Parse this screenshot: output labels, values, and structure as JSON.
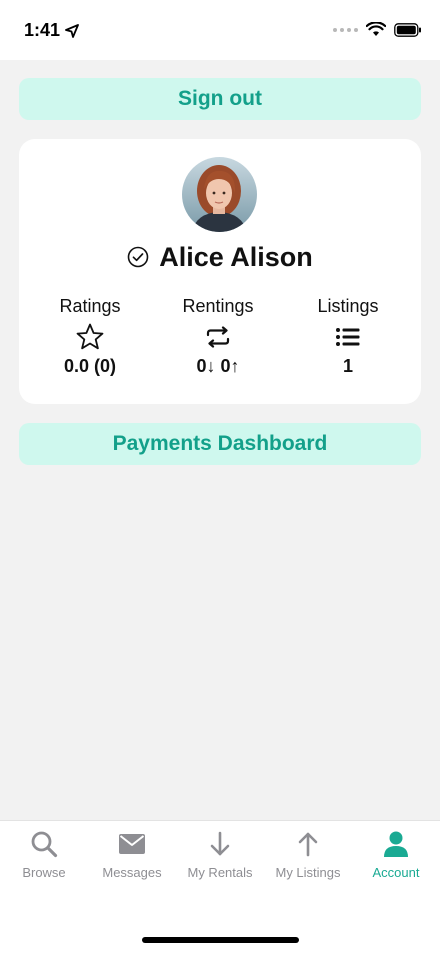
{
  "status_bar": {
    "time": "1:41"
  },
  "header": {
    "sign_out_label": "Sign out"
  },
  "profile": {
    "name": "Alice Alison",
    "stats": {
      "ratings": {
        "label": "Ratings",
        "value": "0.0 (0)",
        "icon": "star-icon"
      },
      "rentings": {
        "label": "Rentings",
        "value": "0↓ 0↑",
        "icon": "repeat-icon"
      },
      "listings": {
        "label": "Listings",
        "value": "1",
        "icon": "list-icon"
      }
    }
  },
  "payments": {
    "label": "Payments Dashboard"
  },
  "tabs": [
    {
      "label": "Browse",
      "icon": "search-icon",
      "active": false
    },
    {
      "label": "Messages",
      "icon": "mail-icon",
      "active": false
    },
    {
      "label": "My Rentals",
      "icon": "arrow-down-icon",
      "active": false
    },
    {
      "label": "My Listings",
      "icon": "arrow-up-icon",
      "active": false
    },
    {
      "label": "Account",
      "icon": "person-icon",
      "active": true
    }
  ],
  "colors": {
    "accent": "#1aaa93",
    "button_bg": "#cff8ee",
    "inactive": "#8e8e93"
  }
}
